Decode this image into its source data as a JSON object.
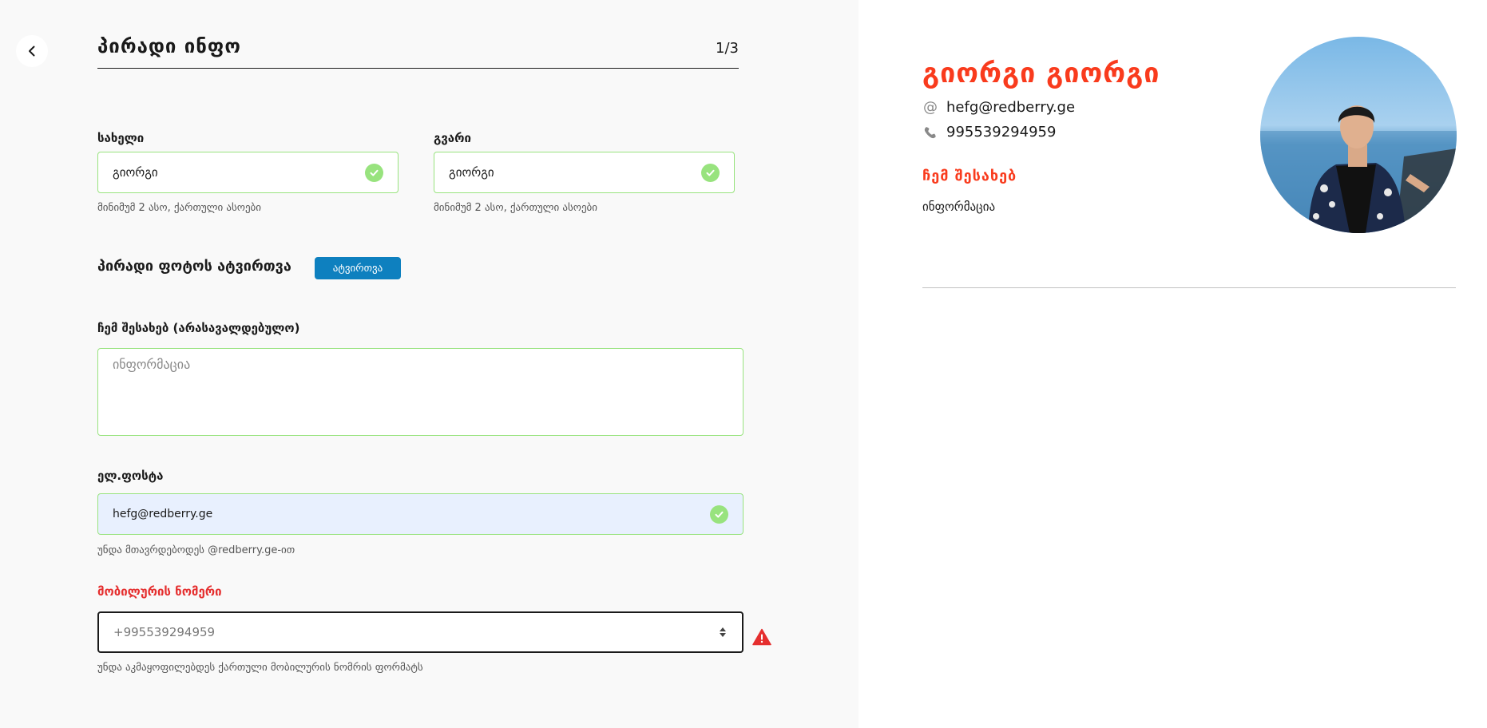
{
  "header": {
    "title": "პირადი ინფო",
    "step": "1/3"
  },
  "form": {
    "first_name": {
      "label": "სახელი",
      "value": "გიორგი",
      "hint": "მინიმუმ 2 ასო, ქართული ასოები"
    },
    "last_name": {
      "label": "გვარი",
      "value": "გიორგი",
      "hint": "მინიმუმ 2 ასო, ქართული ასოები"
    },
    "photo": {
      "label": "პირადი ფოტოს ატვირთვა",
      "button": "ატვირთვა"
    },
    "about": {
      "label": "ჩემ შესახებ (არასავალდებულო)",
      "placeholder": "ინფორმაცია"
    },
    "email": {
      "label": "ელ.ფოსტა",
      "value": "hefg@redberry.ge",
      "hint": "უნდა მთავრდებოდეს @redberry.ge-ით"
    },
    "phone": {
      "label": "მობილურის ნომერი",
      "value": "+995539294959",
      "hint": "უნდა აკმაყოფილებდეს ქართული მობილურის ნომრის ფორმატს"
    }
  },
  "preview": {
    "name": "გიორგი  გიორგი",
    "email": "hefg@redberry.ge",
    "phone": "995539294959",
    "about_title": "ჩემ შესახებ",
    "about_text": "ინფორმაცია"
  },
  "colors": {
    "accent_red": "#f93b1d",
    "error_red": "#e52f2f",
    "valid_green": "#98e37e",
    "upload_blue": "#0e80bf"
  },
  "icons": {
    "back": "chevron-left-icon",
    "valid": "check-circle-icon",
    "error": "warning-triangle-icon",
    "email": "at-icon",
    "phone": "phone-icon"
  }
}
